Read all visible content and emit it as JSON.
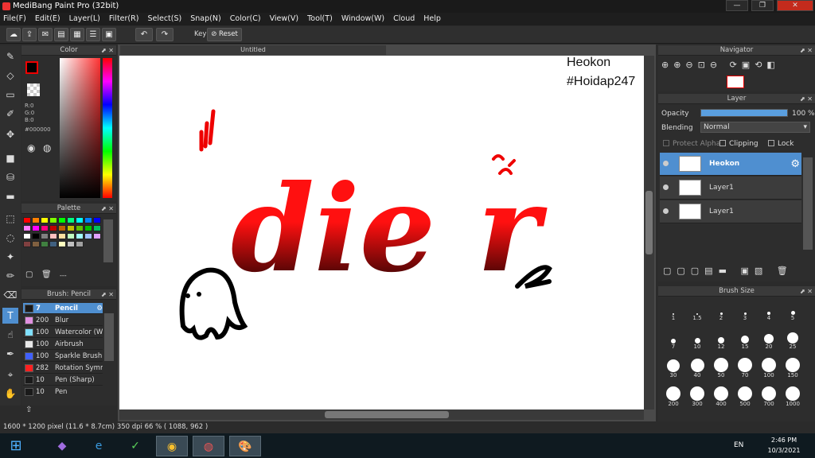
{
  "window": {
    "title": "MediBang Paint Pro (32bit)",
    "min": "—",
    "max": "❐",
    "close": "✕"
  },
  "menu": [
    "File(F)",
    "Edit(E)",
    "Layer(L)",
    "Filter(R)",
    "Select(S)",
    "Snap(N)",
    "Color(C)",
    "View(V)",
    "Tool(T)",
    "Window(W)",
    "Cloud",
    "Help"
  ],
  "toolbar": {
    "key_label": "Key",
    "reset_label": "Reset"
  },
  "color_panel": {
    "title": "Color",
    "r": "R:0",
    "g": "G:0",
    "b": "B:0",
    "hex": "#000000"
  },
  "palette_panel": {
    "title": "Palette",
    "extra": "---"
  },
  "palette_colors": [
    "#ff0000",
    "#ff8000",
    "#ffff00",
    "#80ff00",
    "#00ff00",
    "#00ff80",
    "#00ffff",
    "#0080ff",
    "#0000ff",
    "#ff80ff",
    "#ff00ff",
    "#ff0080",
    "#c00000",
    "#c06000",
    "#c0c000",
    "#60c000",
    "#00c000",
    "#00c060",
    "#ffffff",
    "#000000",
    "#808080",
    "#ffc0c0",
    "#ffe0a0",
    "#c0ffc0",
    "#a0ffff",
    "#a0c0ff",
    "#e0a0ff",
    "#804040",
    "#806040",
    "#408040",
    "#406080",
    "#ffffc0",
    "#c0c0c0",
    "#a0a0a0"
  ],
  "brush_panel": {
    "title": "Brush: Pencil",
    "items": [
      {
        "size": "7",
        "name": "Pencil",
        "color": "#1a1a1a"
      },
      {
        "size": "200",
        "name": "Blur",
        "color": "#e090e0"
      },
      {
        "size": "100",
        "name": "Watercolor (W",
        "color": "#80e0ff"
      },
      {
        "size": "100",
        "name": "Airbrush",
        "color": "#e8e8e8"
      },
      {
        "size": "100",
        "name": "Sparkle Brush",
        "color": "#4060ff"
      },
      {
        "size": "282",
        "name": "Rotation Symm",
        "color": "#ff2020"
      },
      {
        "size": "10",
        "name": "Pen (Sharp)",
        "color": "#1a1a1a"
      },
      {
        "size": "10",
        "name": "Pen",
        "color": "#1a1a1a"
      }
    ]
  },
  "canvas": {
    "tab": "Untitled",
    "text_line1": "Heokon",
    "text_line2": "#Hoidap247",
    "art_text": "die r"
  },
  "status": {
    "text": "1600 * 1200 pixel  (11.6 * 8.7cm)  350 dpi  66 %  ( 1088, 962 )"
  },
  "navigator": {
    "title": "Navigator"
  },
  "layer_panel": {
    "title": "Layer",
    "opacity_label": "Opacity",
    "opacity_value": "100 %",
    "opacity_fraction": 1.0,
    "blending_label": "Blending",
    "blending_value": "Normal",
    "protect_alpha": "Protect Alpha",
    "clipping": "Clipping",
    "lock": "Lock",
    "layers": [
      {
        "name": "Heokon",
        "selected": true
      },
      {
        "name": "Layer1",
        "selected": false
      },
      {
        "name": "Layer1",
        "selected": false
      }
    ]
  },
  "brush_size_panel": {
    "title": "Brush Size",
    "sizes": [
      "1",
      "1.5",
      "2",
      "3",
      "4",
      "5",
      "7",
      "10",
      "12",
      "15",
      "20",
      "25",
      "30",
      "40",
      "50",
      "70",
      "100",
      "150",
      "200",
      "300",
      "400",
      "500",
      "700",
      "1000"
    ]
  },
  "taskbar": {
    "lang": "EN",
    "time": "2:46 PM",
    "date": "10/3/2021"
  }
}
